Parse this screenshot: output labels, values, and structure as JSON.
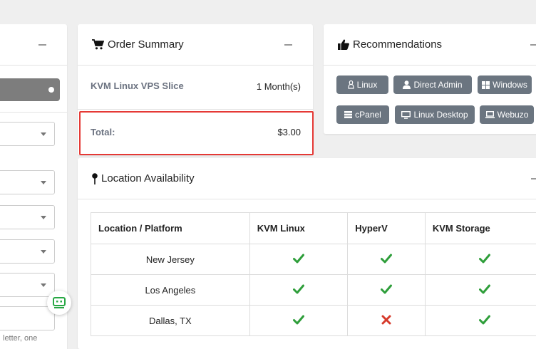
{
  "left_panel": {
    "hint_text": "letter, one"
  },
  "order_summary": {
    "title": "Order Summary",
    "product": "KVM Linux VPS Slice",
    "billing_cycle": "1 Month(s)",
    "total_label": "Total:",
    "total_value": "$3.00"
  },
  "recommendations": {
    "title": "Recommendations",
    "tags": [
      {
        "label": "Linux",
        "icon": "linux-icon"
      },
      {
        "label": "Direct Admin",
        "icon": "user-icon"
      },
      {
        "label": "Windows",
        "icon": "windows-icon"
      },
      {
        "label": "cPanel",
        "icon": "server-icon"
      },
      {
        "label": "Linux Desktop",
        "icon": "desktop-icon"
      },
      {
        "label": "Webuzo",
        "icon": "laptop-icon"
      }
    ]
  },
  "location": {
    "title": "Location Availability",
    "headers": [
      "Location / Platform",
      "KVM Linux",
      "HyperV",
      "KVM Storage"
    ],
    "rows": [
      {
        "city": "New Jersey",
        "kvm_linux": "available",
        "hyperv": "available",
        "kvm_storage": "available"
      },
      {
        "city": "Los Angeles",
        "kvm_linux": "available",
        "hyperv": "available",
        "kvm_storage": "available"
      },
      {
        "city": "Dallas, TX",
        "kvm_linux": "available",
        "hyperv": "unavailable",
        "kvm_storage": "available"
      }
    ]
  },
  "colors": {
    "check": "#2e9e3a",
    "cross": "#d63a2b",
    "highlight_border": "#e53935",
    "tag_bg": "#6b7580"
  }
}
